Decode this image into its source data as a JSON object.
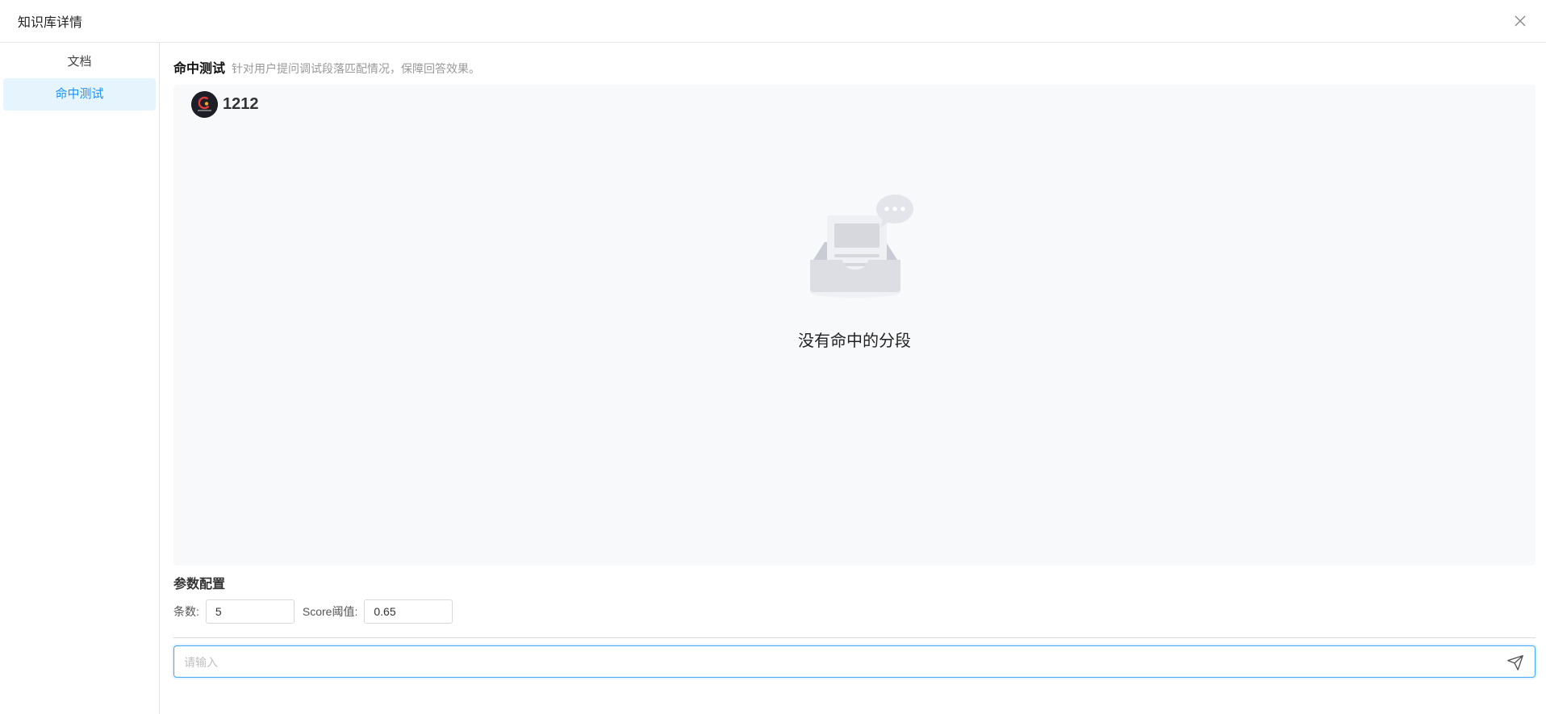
{
  "header": {
    "title": "知识库详情"
  },
  "sidebar": {
    "items": [
      {
        "label": "文档",
        "active": false
      },
      {
        "label": "命中测试",
        "active": true
      }
    ]
  },
  "main": {
    "section_title": "命中测试",
    "section_desc": "针对用户提问调试段落匹配情况，保障回答效果。",
    "knowledge_base": {
      "name": "1212"
    },
    "empty_state": {
      "text": "没有命中的分段"
    },
    "params": {
      "title": "参数配置",
      "count_label": "条数:",
      "count_value": "5",
      "score_label": "Score阈值:",
      "score_value": "0.65"
    },
    "query": {
      "placeholder": "请输入",
      "value": ""
    }
  },
  "icons": {
    "close": "close-icon",
    "send": "send-icon",
    "empty": "empty-inbox-illustration"
  },
  "colors": {
    "accent": "#1890ff",
    "active_bg": "#e6f4fd",
    "panel_bg": "#f8f9fb"
  }
}
